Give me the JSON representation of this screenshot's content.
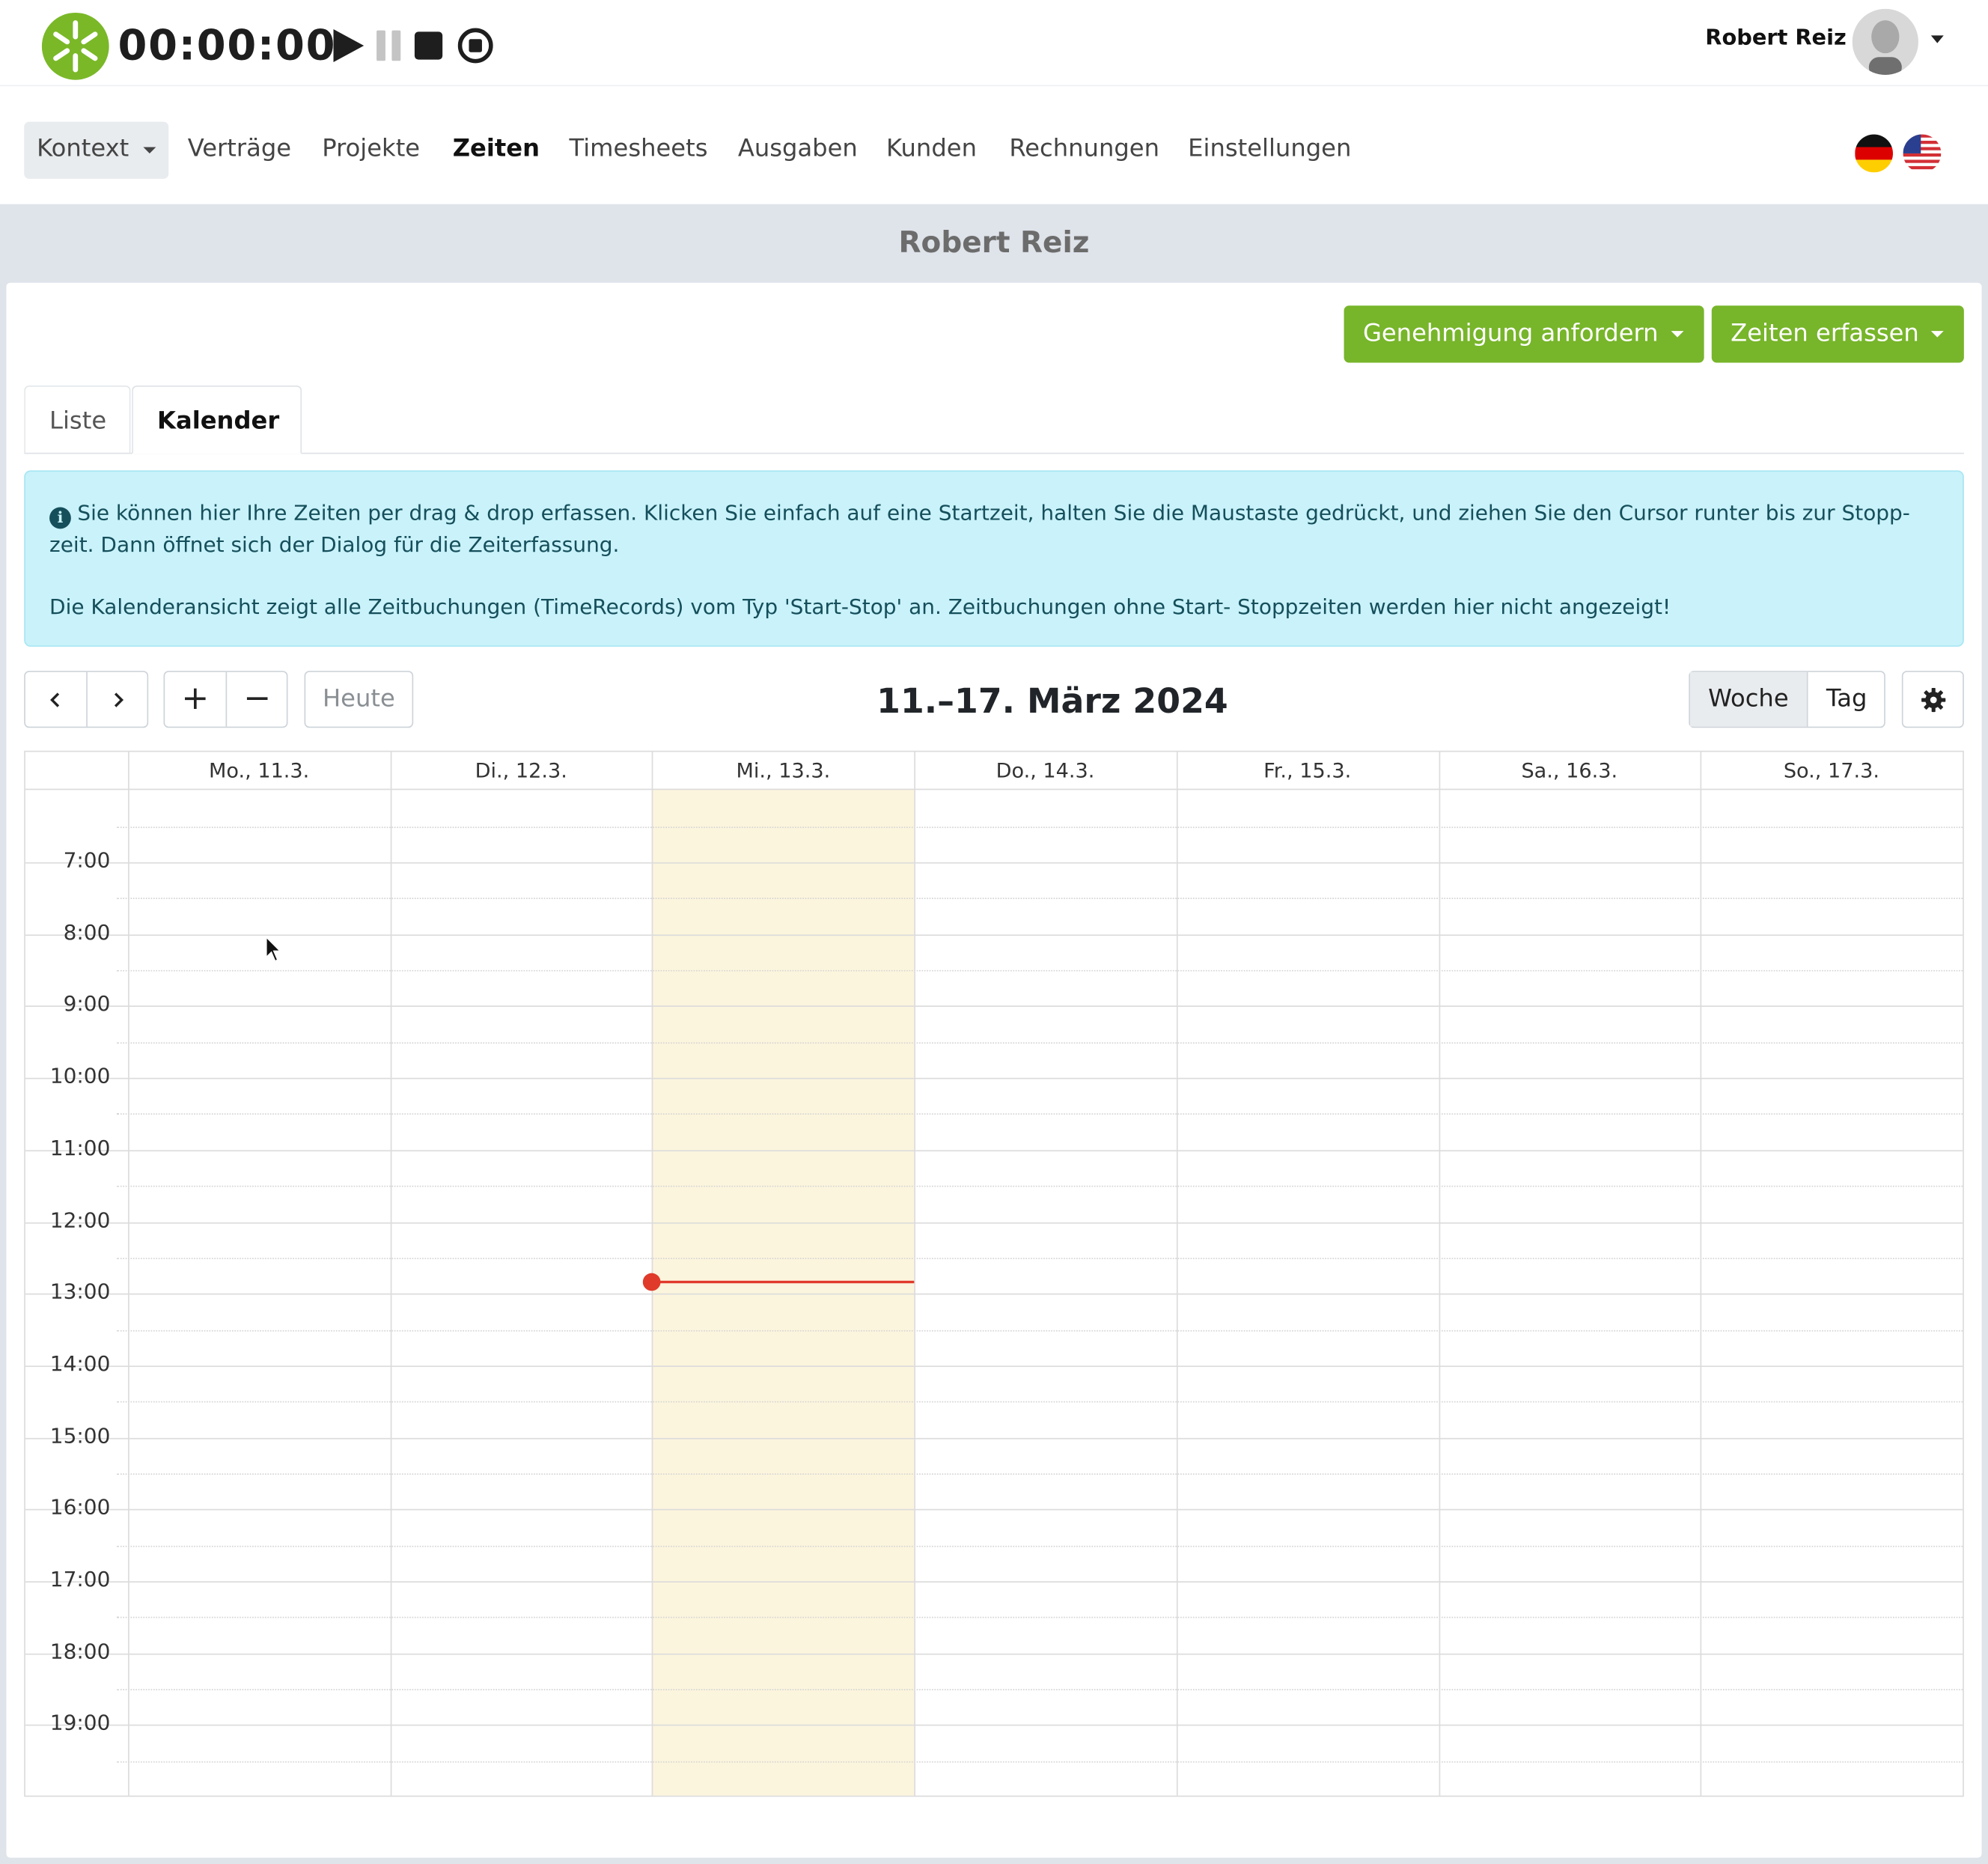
{
  "header": {
    "timer": "00:00:00",
    "user_name": "Robert Reiz"
  },
  "nav": {
    "kontext": "Kontext",
    "items": [
      "Verträge",
      "Projekte",
      "Zeiten",
      "Timesheets",
      "Ausgaben",
      "Kunden",
      "Rechnungen",
      "Einstellungen"
    ],
    "active": "Zeiten"
  },
  "page": {
    "title": "Robert Reiz",
    "approval_button": "Genehmigung anfordern",
    "record_button": "Zeiten erfassen"
  },
  "tabs": {
    "list": "Liste",
    "calendar": "Kalender",
    "active": "Kalender"
  },
  "alert": {
    "line1": "Sie können hier Ihre Zeiten per drag & drop erfassen. Klicken Sie einfach auf eine Startzeit, halten Sie die Maustaste gedrückt, und ziehen Sie den Cursor runter bis zur Stopp-zeit. Dann öffnet sich der Dialog für die Zeiterfassung.",
    "line2": "Die Kalenderansicht zeigt alle Zeitbuchungen (TimeRecords) vom Typ 'Start-Stop' an. Zeitbuchungen ohne Start- Stoppzeiten werden hier nicht angezeigt!"
  },
  "toolbar": {
    "prev": "‹",
    "next": "›",
    "zoom_in": "+",
    "zoom_out": "−",
    "today": "Heute",
    "title": "11.–17. März 2024",
    "week": "Woche",
    "day": "Tag",
    "active_view": "Woche"
  },
  "calendar": {
    "days": [
      "Mo., 11.3.",
      "Di., 12.3.",
      "Mi., 13.3.",
      "Do., 14.3.",
      "Fr., 15.3.",
      "Sa., 16.3.",
      "So., 17.3."
    ],
    "today_index": 2,
    "hours": [
      "7:00",
      "8:00",
      "9:00",
      "10:00",
      "11:00",
      "12:00",
      "13:00",
      "14:00",
      "15:00",
      "16:00",
      "17:00",
      "18:00",
      "19:00"
    ],
    "now_time": "12:50"
  },
  "colors": {
    "brand_green": "#77b52a",
    "today_bg": "#fcf5dd",
    "now_indicator": "#e03a2b",
    "info_bg": "#c9f2fa"
  }
}
